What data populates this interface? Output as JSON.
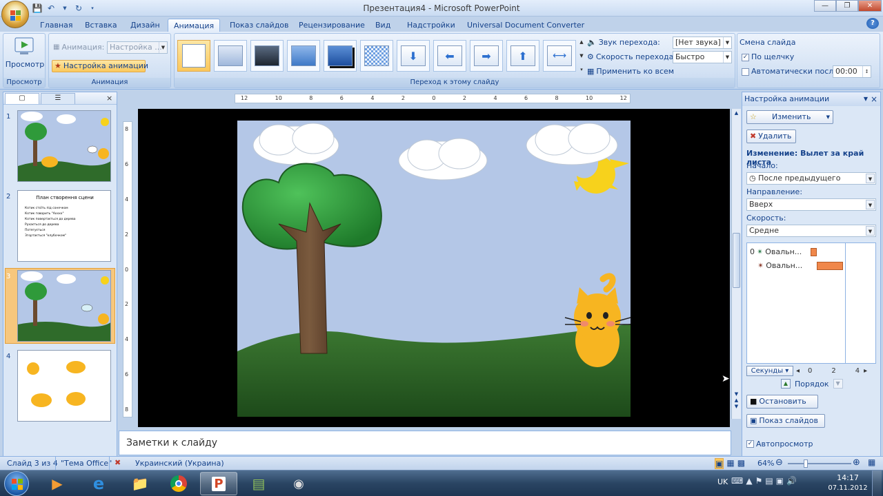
{
  "window": {
    "title": "Презентация4 - Microsoft PowerPoint"
  },
  "tabs": [
    "Главная",
    "Вставка",
    "Дизайн",
    "Анимация",
    "Показ слайдов",
    "Рецензирование",
    "Вид",
    "Надстройки",
    "Universal Document Converter"
  ],
  "ribbon": {
    "preview": {
      "label": "Просмотр",
      "group": "Просмотр"
    },
    "animation": {
      "anim_label": "Анимация:",
      "anim_value": "Настройка ...",
      "custom_btn": "Настройка анимации",
      "group": "Анимация"
    },
    "transition": {
      "group": "Переход к этому слайду",
      "sound_label": "Звук перехода:",
      "sound_value": "[Нет звука]",
      "speed_label": "Скорость перехода:",
      "speed_value": "Быстро",
      "apply_all": "Применить ко всем"
    },
    "advance": {
      "title": "Смена слайда",
      "on_click": "По щелчку",
      "auto_after": "Автоматически после:",
      "auto_time": "00:00"
    }
  },
  "slides_pane": {
    "slide_numbers": [
      "1",
      "2",
      "3",
      "4"
    ],
    "slide2": {
      "title": "План створення сцени",
      "items": [
        "Котик стоїть під сонечком",
        "Котик говорить \"Ахххх\"",
        "Котик повертається до дерева",
        "Рухається до дерева",
        "Потягується",
        "Згортається \"клубочком\""
      ]
    }
  },
  "ruler": {
    "h_labels": [
      "12",
      "10",
      "8",
      "6",
      "4",
      "2",
      "0",
      "2",
      "4",
      "6",
      "8",
      "10",
      "12"
    ],
    "v_labels": [
      "8",
      "6",
      "4",
      "2",
      "0",
      "2",
      "4",
      "6",
      "8"
    ]
  },
  "notes": {
    "placeholder": "Заметки к слайду"
  },
  "task_pane": {
    "title": "Настройка анимации",
    "change_btn": "Изменить",
    "delete_btn": "Удалить",
    "effect_heading": "Изменение: Вылет за край листа",
    "start_label": "Начало:",
    "start_value": "После предыдущего",
    "direction_label": "Направление:",
    "direction_value": "Вверх",
    "speed_label": "Скорость:",
    "speed_value": "Средне",
    "anim_items": [
      {
        "index": "0",
        "name": "Овальн..."
      },
      {
        "index": "",
        "name": "Овальн..."
      }
    ],
    "timeline": {
      "unit": "Секунды",
      "ticks": [
        "0",
        "2",
        "4"
      ]
    },
    "order_label": "Порядок",
    "stop_btn": "Остановить",
    "slideshow_btn": "Показ слайдов",
    "autopreview": "Автопросмотр"
  },
  "status": {
    "slide": "Слайд 3 из 4",
    "theme": "\"Тема Office\"",
    "language": "Украинский (Украина)",
    "zoom": "64%"
  },
  "taskbar": {
    "lang": "UK",
    "time": "14:17",
    "date": "07.11.2012"
  }
}
